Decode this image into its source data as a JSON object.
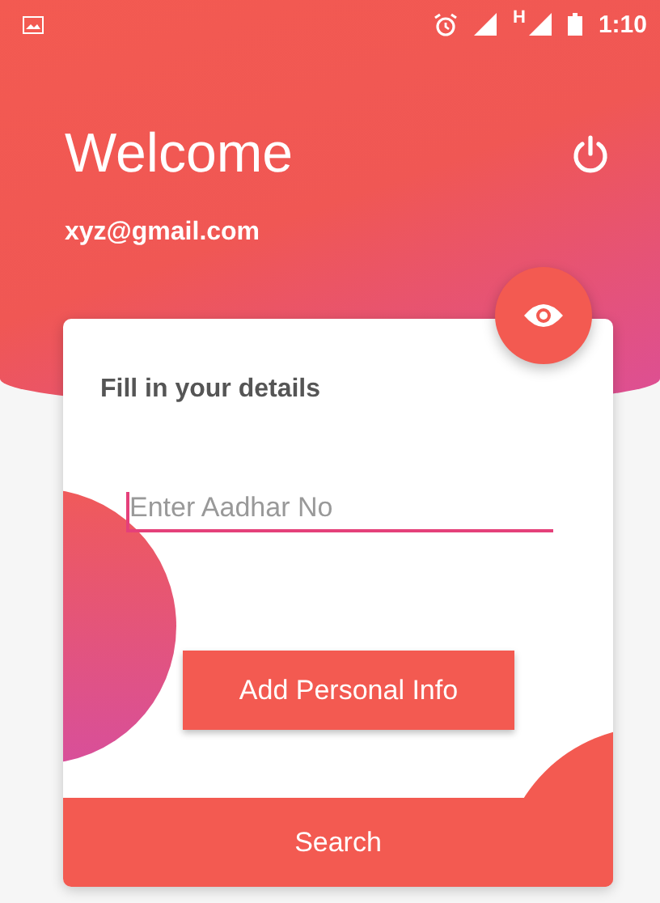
{
  "status_bar": {
    "network": "H",
    "time": "1:10"
  },
  "header": {
    "title": "Welcome",
    "email": "xyz@gmail.com"
  },
  "card": {
    "title": "Fill in your details",
    "field": {
      "placeholder": "Enter Aadhar No"
    },
    "button": "Add Personal Info",
    "footer_button": "Search"
  }
}
